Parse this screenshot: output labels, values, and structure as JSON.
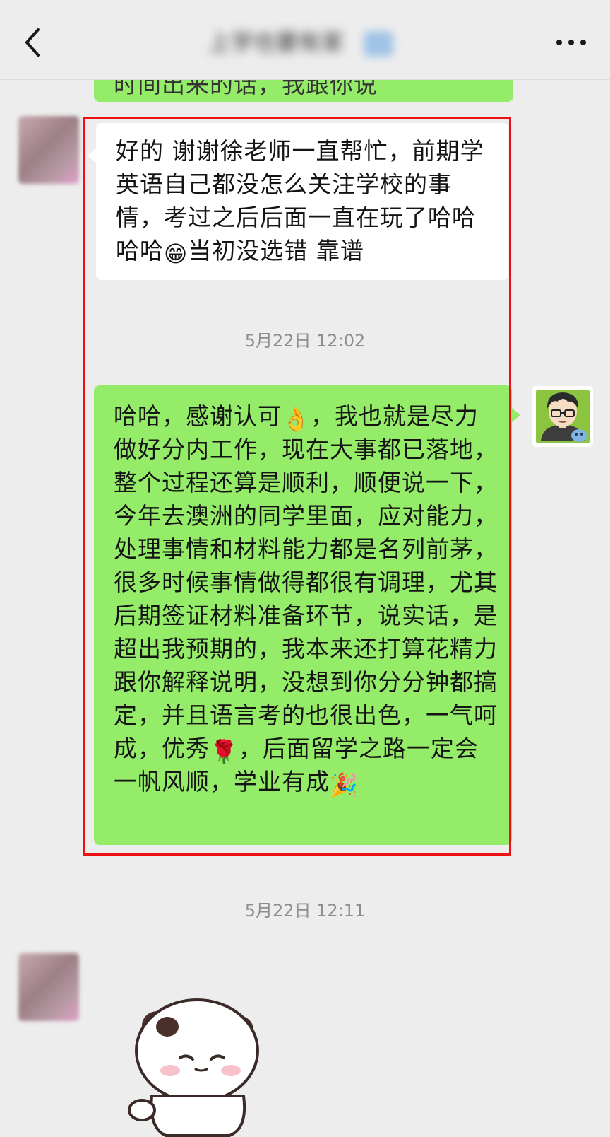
{
  "header": {
    "title": "上学也要有家",
    "back_icon": "chevron-left-icon",
    "more_icon": "ellipsis-icon"
  },
  "messages": {
    "previous": {
      "text": "时间出来的话，我跟你说"
    },
    "incoming_1": {
      "text_before": "好的 谢谢徐老师一直帮忙，前期学英语自己都没怎么关注学校的事情，考过之后后面一直在玩了哈哈哈哈",
      "emoji_1": "😁",
      "text_after": "当初没选错 靠谱"
    },
    "timestamp_1": "5月22日 12:02",
    "outgoing_1": {
      "text_part1": "哈哈，感谢认可",
      "emoji_1": "👌",
      "text_part2": "，我也就是尽力做好分内工作，现在大事都已落地，整个过程还算是顺利，顺便说一下，今年去澳洲的同学里面，应对能力，处理事情和材料能力都是名列前茅，很多时候事情做得都很有调理，尤其后期签证材料准备环节，说实话，是超出我预期的，我本来还打算花精力跟你解释说明，没想到你分分钟都搞定，并且语言考的也很出色，一气呵成，优秀",
      "emoji_2": "🌹",
      "text_part3": "，后面留学之路一定会一帆风顺，学业有成",
      "emoji_3": "🎉"
    },
    "timestamp_2": "5月22日 12:11"
  },
  "colors": {
    "background": "#ededed",
    "outgoing_bubble": "#95ec69",
    "incoming_bubble": "#ffffff",
    "highlight_border": "#ee1111",
    "timestamp_text": "#8e8e8e"
  }
}
